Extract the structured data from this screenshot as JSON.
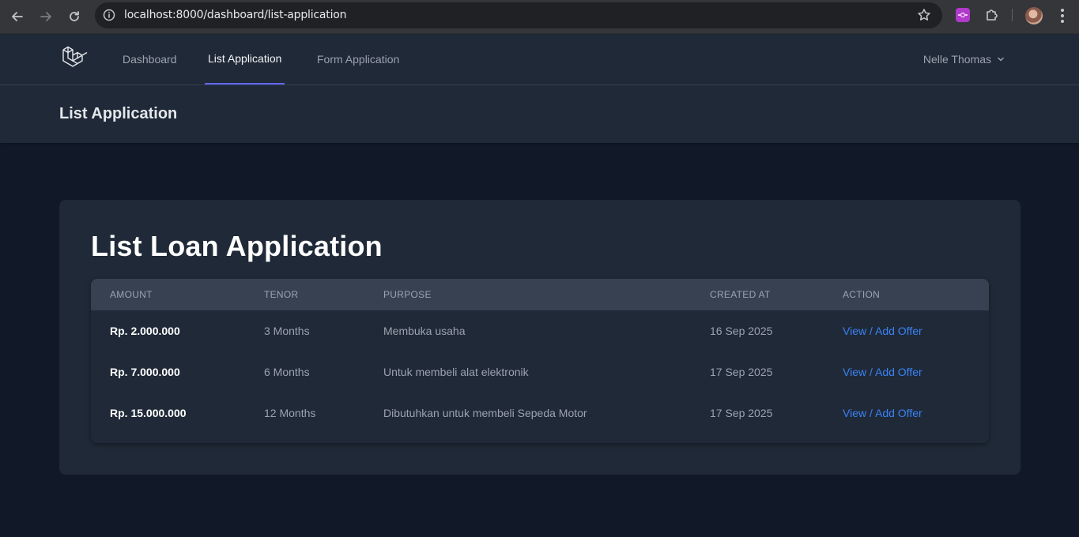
{
  "browser": {
    "url": "localhost:8000/dashboard/list-application"
  },
  "nav": {
    "links": [
      "Dashboard",
      "List Application",
      "Form Application"
    ],
    "active": "List Application",
    "user_name": "Nelle Thomas"
  },
  "header": {
    "title": "List Application"
  },
  "card": {
    "title": "List Loan Application"
  },
  "table": {
    "headers": [
      "AMOUNT",
      "TENOR",
      "PURPOSE",
      "CREATED AT",
      "ACTION"
    ],
    "rows": [
      {
        "amount": "Rp. 2.000.000",
        "tenor": "3 Months",
        "purpose": "Membuka usaha",
        "created_at": "16 Sep 2025",
        "action": "View / Add Offer"
      },
      {
        "amount": "Rp. 7.000.000",
        "tenor": "6 Months",
        "purpose": "Untuk membeli alat elektronik",
        "created_at": "17 Sep 2025",
        "action": "View / Add Offer"
      },
      {
        "amount": "Rp. 15.000.000",
        "tenor": "12 Months",
        "purpose": "Dibutuhkan untuk membeli Sepeda Motor",
        "created_at": "17 Sep 2025",
        "action": "View / Add Offer"
      }
    ]
  },
  "colors": {
    "accent": "#6366f1",
    "link": "#3b82f6",
    "background": "#111827",
    "surface": "#1f2937"
  },
  "icons": [
    "back-icon",
    "forward-icon",
    "reload-icon",
    "site-info-icon",
    "star-icon",
    "extension-icon",
    "puzzle-icon",
    "profile-avatar",
    "menu-icon",
    "laravel-logo",
    "chevron-down-icon"
  ]
}
